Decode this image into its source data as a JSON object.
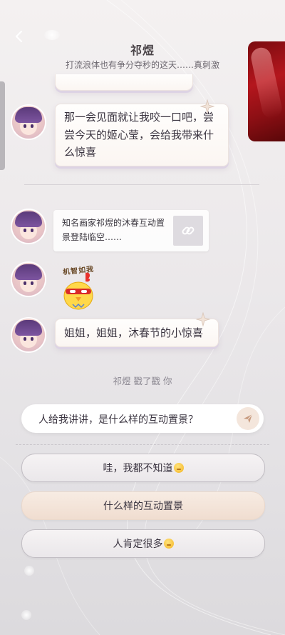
{
  "header": {
    "back_icon": "chevron-left-icon",
    "title": "祁煜",
    "subtitle": "打流浪体也有争分夺秒的这天……真刺激"
  },
  "messages": [
    {
      "type": "text",
      "text": "那一会见面就让我咬一口吧，尝尝今天的姬心莹，会给我带来什么惊喜"
    },
    {
      "type": "link",
      "text": "知名画家祁煜的沐春互动置景登陆临空……",
      "icon": "link-icon"
    },
    {
      "type": "sticker",
      "caption": "机智如我"
    },
    {
      "type": "text",
      "text": "姐姐，姐姐，沐春节的小惊喜"
    }
  ],
  "poke_notice": "祁煜 戳了戳 你",
  "input": {
    "value": "人给我讲讲，是什么样的互动置景？",
    "send_icon": "send-icon"
  },
  "options": [
    {
      "label": "哇，我都不知道",
      "emoji": true,
      "selected": false
    },
    {
      "label": "什么样的互动置景",
      "emoji": false,
      "selected": true
    },
    {
      "label": "人肯定很多",
      "emoji": true,
      "selected": false
    }
  ],
  "colors": {
    "accent": "#f0ddd0",
    "card_red": "#b4161d",
    "avatar_hair": "#5b3a7a"
  }
}
